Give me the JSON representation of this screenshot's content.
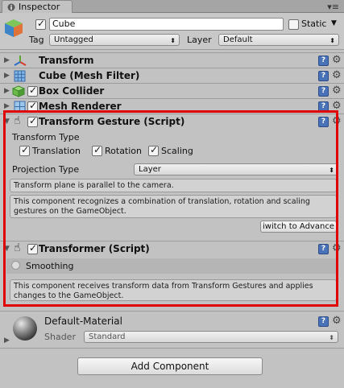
{
  "tab": {
    "title": "Inspector",
    "icon": "info-icon"
  },
  "header": {
    "active": true,
    "name": "Cube",
    "static_label": "Static",
    "static_checked": false,
    "tag_label": "Tag",
    "tag_value": "Untagged",
    "layer_label": "Layer",
    "layer_value": "Default"
  },
  "components": [
    {
      "title": "Transform",
      "icon": "transform-axes-icon",
      "has_checkbox": false
    },
    {
      "title": "Cube (Mesh Filter)",
      "icon": "mesh-filter-icon",
      "has_checkbox": false
    },
    {
      "title": "Box Collider",
      "icon": "box-collider-icon",
      "has_checkbox": true,
      "checked": true
    },
    {
      "title": "Mesh Renderer",
      "icon": "mesh-renderer-icon",
      "has_checkbox": true,
      "checked": true
    }
  ],
  "transform_gesture": {
    "title": "Transform Gesture (Script)",
    "icon": "hand-icon",
    "checked": true,
    "transform_type_label": "Transform Type",
    "options": [
      {
        "label": "Translation",
        "checked": true
      },
      {
        "label": "Rotation",
        "checked": true
      },
      {
        "label": "Scaling",
        "checked": true
      }
    ],
    "projection_label": "Projection Type",
    "projection_value": "Layer",
    "info_plane": "Transform plane is parallel to the camera.",
    "info_desc": "This component recognizes a combination of translation, rotation and scaling gestures on the GameObject.",
    "advanced_button": "iwitch to Advance"
  },
  "transformer": {
    "title": "Transformer (Script)",
    "icon": "hand-icon",
    "checked": true,
    "smoothing_label": "Smoothing",
    "smoothing_on": false,
    "info_desc": "This component receives transform data from Transform Gestures and applies changes to the GameObject."
  },
  "material": {
    "name": "Default-Material",
    "shader_label": "Shader",
    "shader_value": "Standard"
  },
  "add_component_label": "Add Component",
  "colors": {
    "highlight": "#e00000",
    "help_blue": "#4a72b8"
  }
}
